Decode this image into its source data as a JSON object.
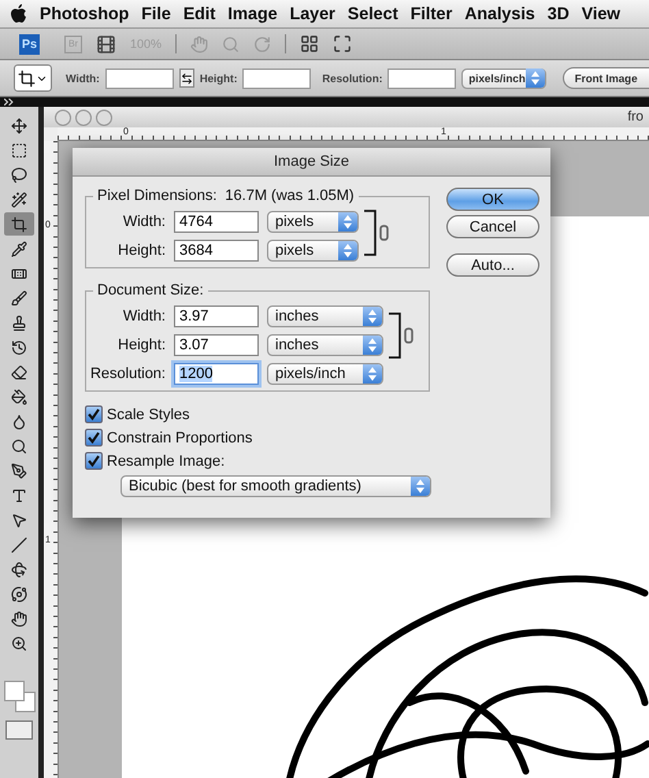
{
  "menu_bar": {
    "app_name": "Photoshop",
    "menus": [
      "File",
      "Edit",
      "Image",
      "Layer",
      "Select",
      "Filter",
      "Analysis",
      "3D",
      "View"
    ]
  },
  "app_bar": {
    "logo": "Ps",
    "bridge": "Br",
    "zoom": "100%",
    "zoom_disabled": true
  },
  "options_bar": {
    "width_label": "Width:",
    "height_label": "Height:",
    "resolution_label": "Resolution:",
    "units": "pixels/inch",
    "button": "Front Image"
  },
  "tools": [
    {
      "kind": "move",
      "selected": false
    },
    {
      "kind": "marquee",
      "selected": false
    },
    {
      "kind": "lasso",
      "selected": false
    },
    {
      "kind": "wand",
      "selected": false
    },
    {
      "kind": "crop",
      "selected": true
    },
    {
      "kind": "eyedropper",
      "selected": false
    },
    {
      "kind": "healing",
      "selected": false
    },
    {
      "kind": "brush",
      "selected": false
    },
    {
      "kind": "stamp",
      "selected": false
    },
    {
      "kind": "history",
      "selected": false
    },
    {
      "kind": "eraser",
      "selected": false
    },
    {
      "kind": "bucket",
      "selected": false
    },
    {
      "kind": "blur",
      "selected": false
    },
    {
      "kind": "dodge",
      "selected": false
    },
    {
      "kind": "pen",
      "selected": false
    },
    {
      "kind": "type",
      "selected": false
    },
    {
      "kind": "select",
      "selected": false
    },
    {
      "kind": "line",
      "selected": false
    },
    {
      "kind": "rotate3d",
      "selected": false
    },
    {
      "kind": "orbit3d",
      "selected": false
    },
    {
      "kind": "hand",
      "selected": false
    },
    {
      "kind": "zoom",
      "selected": false
    }
  ],
  "document": {
    "title": "fro",
    "top_ruler": [
      "0",
      "1"
    ],
    "left_ruler": [
      "0",
      "1"
    ]
  },
  "dialog": {
    "title": "Image Size",
    "pixel_dimensions": {
      "label": "Pixel Dimensions:",
      "size": "16.7M (was 1.05M)",
      "fields": [
        {
          "label": "Width:",
          "value": "4764",
          "unit": "pixels",
          "selected": false
        },
        {
          "label": "Height:",
          "value": "3684",
          "unit": "pixels",
          "selected": false
        }
      ]
    },
    "document_size": {
      "label": "Document Size:",
      "fields": [
        {
          "label": "Width:",
          "value": "3.97",
          "unit": "inches",
          "selected": false
        },
        {
          "label": "Height:",
          "value": "3.07",
          "unit": "inches",
          "selected": false
        },
        {
          "label": "Resolution:",
          "value": "1200",
          "unit": "pixels/inch",
          "selected": true
        }
      ]
    },
    "checkboxes": [
      {
        "label": "Scale Styles",
        "checked": true
      },
      {
        "label": "Constrain Proportions",
        "checked": true
      },
      {
        "label": "Resample Image:",
        "checked": true
      }
    ],
    "resample_method": "Bicubic (best for smooth gradients)",
    "buttons": [
      {
        "label": "OK",
        "default": true
      },
      {
        "label": "Cancel",
        "default": false
      },
      {
        "label": "Auto...",
        "default": false
      }
    ]
  }
}
